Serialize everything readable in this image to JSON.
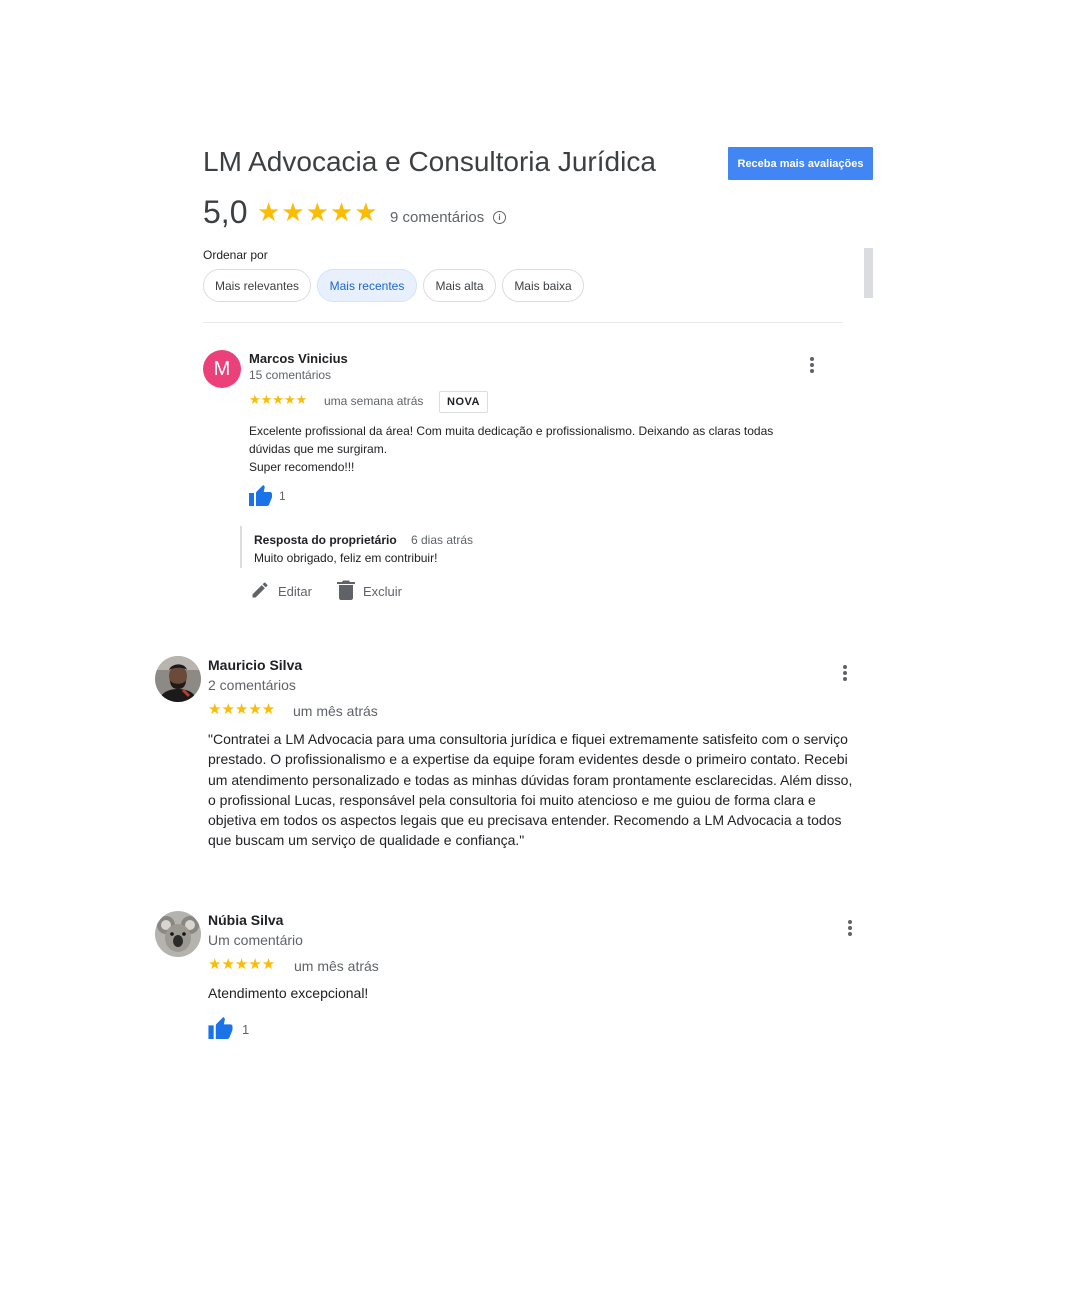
{
  "header": {
    "business_name": "LM Advocacia e Consultoria Jurídica",
    "cta_label": "Receba mais avaliações",
    "rating": "5,0",
    "stars": "★★★★★",
    "review_count": "9 comentários",
    "info_icon": "info-icon"
  },
  "sort": {
    "label": "Ordenar por",
    "options": [
      "Mais relevantes",
      "Mais recentes",
      "Mais alta",
      "Mais baixa"
    ],
    "selected": "Mais recentes"
  },
  "reviews": [
    {
      "avatar_letter": "M",
      "avatar_color": "#ec407a",
      "name": "Marcos Vinicius",
      "count": "15 comentários",
      "stars": "★★★★★",
      "time": "uma semana atrás",
      "badge": "NOVA",
      "text": "Excelente profissional da área! Com muita dedicação e profissionalismo. Deixando as claras todas\ndúvidas que me surgiram.\nSuper recomendo!!!",
      "likes": "1",
      "owner_reply": {
        "label": "Resposta do proprietário",
        "time": "6 dias atrás",
        "text": "Muito obrigado, feliz em contribuir!"
      },
      "actions": {
        "edit": "Editar",
        "delete": "Excluir"
      }
    },
    {
      "name": "Mauricio Silva",
      "count": "2 comentários",
      "stars": "★★★★★",
      "time": "um mês atrás",
      "text": "\"Contratei a LM Advocacia para uma consultoria jurídica e fiquei extremamente satisfeito com o serviço\nprestado. O profissionalismo e a expertise da equipe foram evidentes desde o primeiro contato. Recebi\num atendimento personalizado e todas as minhas dúvidas foram prontamente esclarecidas. Além disso,\no profissional Lucas, responsável pela consultoria foi muito atencioso e me guiou de forma clara e\nobjetiva em todos os aspectos legais que eu precisava entender. Recomendo a LM Advocacia a todos\nque buscam um serviço de qualidade e confiança.\""
    },
    {
      "name": "Núbia Silva",
      "count": "Um comentário",
      "stars": "★★★★★",
      "time": "um mês atrás",
      "text": "Atendimento excepcional!",
      "likes": "1"
    }
  ],
  "colors": {
    "accent": "#4285f4",
    "star": "#fbbc04",
    "like": "#1a73e8",
    "chip_active_bg": "#e8f0fe"
  }
}
